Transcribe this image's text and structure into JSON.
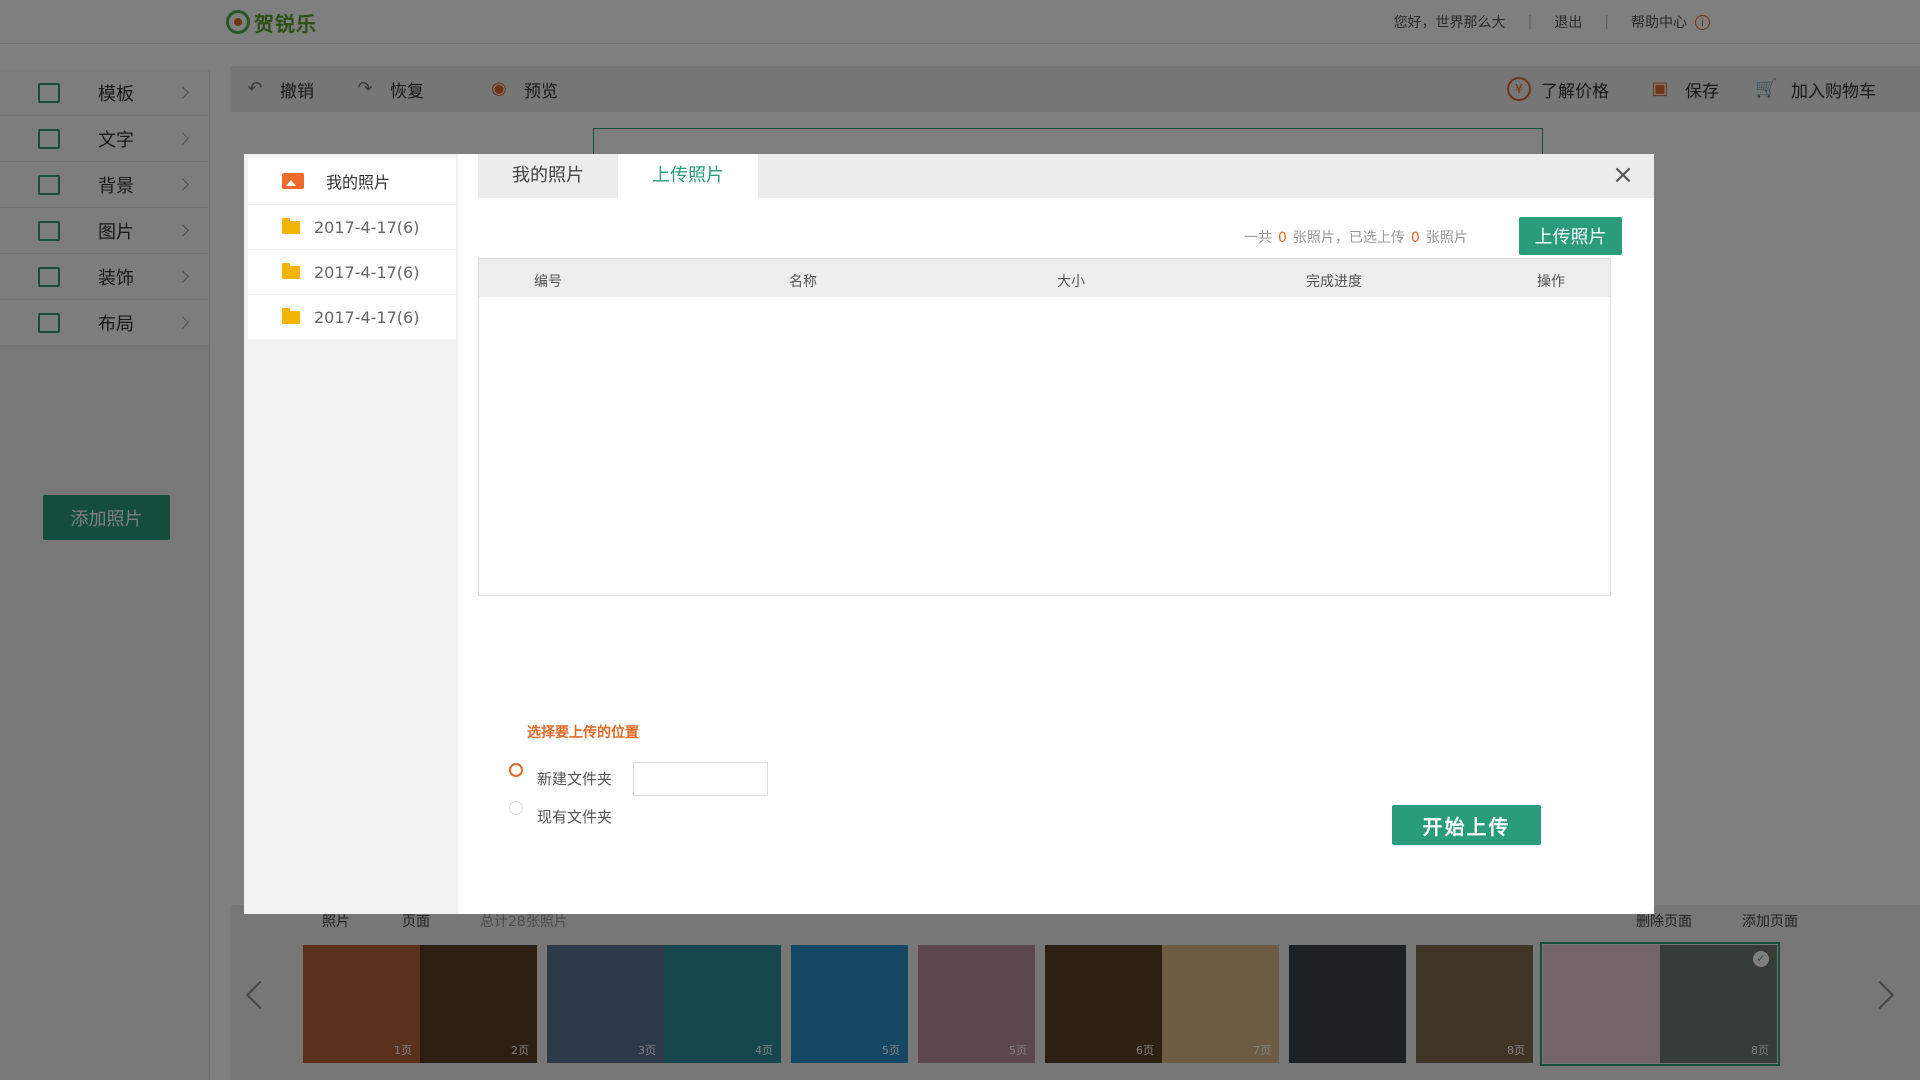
{
  "header": {
    "logo_text": "贺锐乐",
    "greeting": "您好，世界那么大",
    "logout": "退出",
    "help": "帮助中心",
    "info_glyph": "i"
  },
  "sidebar": {
    "items": [
      {
        "label": "模板",
        "icon": "template-icon"
      },
      {
        "label": "文字",
        "icon": "text-icon"
      },
      {
        "label": "背景",
        "icon": "background-icon"
      },
      {
        "label": "图片",
        "icon": "image-icon"
      },
      {
        "label": "装饰",
        "icon": "decoration-icon"
      },
      {
        "label": "布局",
        "icon": "layout-icon"
      }
    ],
    "add_photo": "添加照片"
  },
  "toolbar": {
    "undo": "撤销",
    "redo": "恢复",
    "preview": "预览",
    "price": "了解价格",
    "save": "保存",
    "cart": "加入购物车",
    "undo_glyph": "↶",
    "redo_glyph": "↷",
    "preview_glyph": "◉",
    "price_glyph": "¥",
    "save_glyph": "▣",
    "cart_glyph": "🛒"
  },
  "bottom": {
    "tab_photos": "照片",
    "tab_pages": "页面",
    "total": "总计28张照片",
    "delete_page": "删除页面",
    "add_page": "添加页面",
    "thumbs": [
      {
        "labels": [
          "1页",
          "2页"
        ],
        "colors": [
          "#b5623a",
          "#5a3d24"
        ]
      },
      {
        "labels": [
          "3页",
          "4页"
        ],
        "colors": [
          "#5a7390",
          "#2d8f99"
        ]
      },
      {
        "labels": [
          "5页"
        ],
        "colors": [
          "#2b8fc9"
        ]
      },
      {
        "labels": [
          "5页"
        ],
        "colors": [
          "#b98f98"
        ]
      },
      {
        "labels": [
          "6页",
          "7页"
        ],
        "colors": [
          "#5a4326",
          "#d9b889"
        ]
      },
      {
        "labels": [
          ""
        ],
        "colors": [
          "#3b4249"
        ]
      },
      {
        "labels": [
          "8页"
        ],
        "colors": [
          "#7f6a4e"
        ]
      },
      {
        "labels": [
          "",
          "8页"
        ],
        "colors": [
          "#e7c9d2",
          "#6c7a6c"
        ],
        "selected": true
      }
    ]
  },
  "modal": {
    "side_title": "我的照片",
    "folders": [
      "2017-4-17(6)",
      "2017-4-17(6)",
      "2017-4-17(6)"
    ],
    "tab_my": "我的照片",
    "tab_upload": "上传照片",
    "close": "×",
    "count_prefix": "一共",
    "count_total": "0",
    "count_mid": "张照片，已选上传",
    "count_selected": "0",
    "count_suffix": "张照片",
    "upload_button": "上传照片",
    "columns": [
      "编号",
      "名称",
      "大小",
      "完成进度",
      "操作"
    ],
    "location_title": "选择要上传的位置",
    "option_new": "新建文件夹",
    "option_existing": "现有文件夹",
    "new_folder_value": "",
    "start_button": "开始上传"
  }
}
